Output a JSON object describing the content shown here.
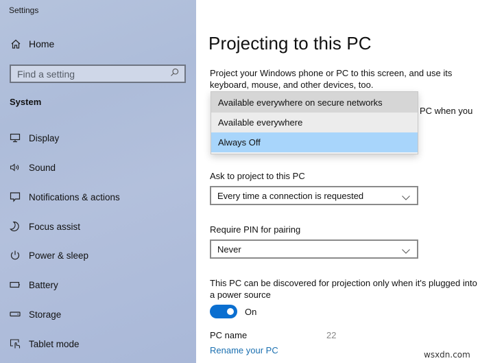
{
  "window": {
    "title": "Settings"
  },
  "sidebar": {
    "home_label": "Home",
    "search": {
      "placeholder": "Find a setting",
      "value": ""
    },
    "section_label": "System",
    "items": [
      {
        "label": "Display",
        "icon": "monitor-icon"
      },
      {
        "label": "Sound",
        "icon": "speaker-icon"
      },
      {
        "label": "Notifications & actions",
        "icon": "notification-icon"
      },
      {
        "label": "Focus assist",
        "icon": "moon-icon"
      },
      {
        "label": "Power & sleep",
        "icon": "power-icon"
      },
      {
        "label": "Battery",
        "icon": "battery-icon"
      },
      {
        "label": "Storage",
        "icon": "storage-icon"
      },
      {
        "label": "Tablet mode",
        "icon": "tablet-mode-icon"
      }
    ]
  },
  "main": {
    "title": "Projecting to this PC",
    "description": "Project your Windows phone or PC to this screen, and use its keyboard, mouse, and other devices, too.",
    "partially_hidden_text": "PC when you",
    "availability_dropdown": {
      "options": [
        "Available everywhere on secure networks",
        "Available everywhere",
        "Always Off"
      ],
      "hovered": "Available everywhere on secure networks",
      "selected": "Always Off"
    },
    "ask_to_project": {
      "label": "Ask to project to this PC",
      "value": "Every time a connection is requested"
    },
    "require_pin": {
      "label": "Require PIN for pairing",
      "value": "Never"
    },
    "power_source": {
      "description": "This PC can be discovered for projection only when it's plugged into a power source",
      "toggle_state": "On",
      "toggle_on": true
    },
    "pc_name": {
      "label": "PC name",
      "value": "22"
    },
    "rename_link": "Rename your PC"
  },
  "watermark": "wsxdn.com",
  "colors": {
    "accent": "#0b6fd0",
    "link": "#1a6fb0",
    "selected_option": "#a8d5fb",
    "hover_option": "#d6d6d6",
    "sidebar_bg": "#b0bedb"
  }
}
